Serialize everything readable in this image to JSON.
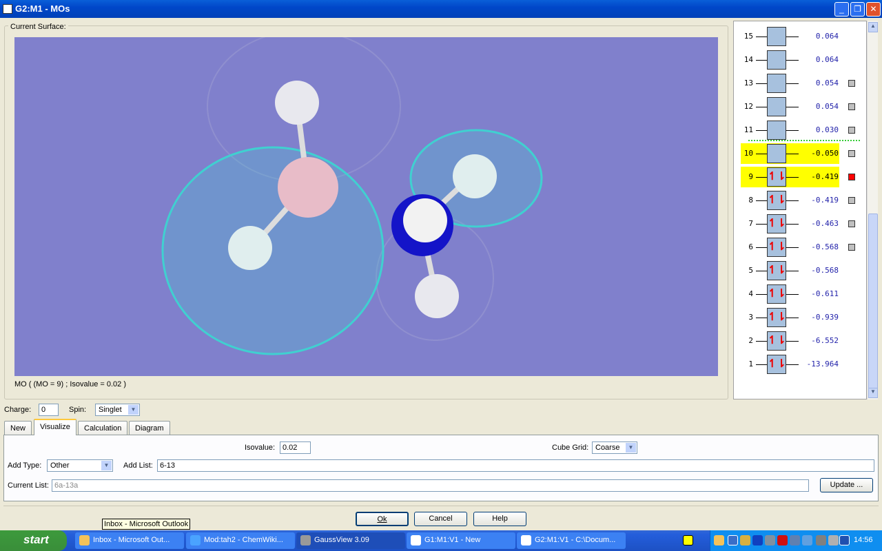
{
  "window": {
    "title": "G2:M1 - MOs"
  },
  "surface": {
    "group_label": "Current Surface:",
    "caption": "MO ( (MO = 9) ; Isovalue = 0.02 )"
  },
  "mo_levels": [
    {
      "n": "15",
      "energy": "0.064",
      "occupied": false,
      "highlight": false,
      "check": "none"
    },
    {
      "n": "14",
      "energy": "0.064",
      "occupied": false,
      "highlight": false,
      "check": "none"
    },
    {
      "n": "13",
      "energy": "0.054",
      "occupied": false,
      "highlight": false,
      "check": "gray"
    },
    {
      "n": "12",
      "energy": "0.054",
      "occupied": false,
      "highlight": false,
      "check": "gray"
    },
    {
      "n": "11",
      "energy": "0.030",
      "occupied": false,
      "highlight": false,
      "check": "gray"
    },
    {
      "n": "10",
      "energy": "-0.050",
      "occupied": false,
      "highlight": true,
      "check": "gray"
    },
    {
      "n": "9",
      "energy": "-0.419",
      "occupied": true,
      "highlight": true,
      "check": "red"
    },
    {
      "n": "8",
      "energy": "-0.419",
      "occupied": true,
      "highlight": false,
      "check": "gray"
    },
    {
      "n": "7",
      "energy": "-0.463",
      "occupied": true,
      "highlight": false,
      "check": "gray"
    },
    {
      "n": "6",
      "energy": "-0.568",
      "occupied": true,
      "highlight": false,
      "check": "gray"
    },
    {
      "n": "5",
      "energy": "-0.568",
      "occupied": true,
      "highlight": false,
      "check": "none"
    },
    {
      "n": "4",
      "energy": "-0.611",
      "occupied": true,
      "highlight": false,
      "check": "none"
    },
    {
      "n": "3",
      "energy": "-0.939",
      "occupied": true,
      "highlight": false,
      "check": "none"
    },
    {
      "n": "2",
      "energy": "-6.552",
      "occupied": true,
      "highlight": false,
      "check": "none"
    },
    {
      "n": "1",
      "energy": "-13.964",
      "occupied": true,
      "highlight": false,
      "check": "none"
    }
  ],
  "charge": {
    "label": "Charge:",
    "value": "0"
  },
  "spin": {
    "label": "Spin:",
    "value": "Singlet"
  },
  "tabs": [
    "New",
    "Visualize",
    "Calculation",
    "Diagram"
  ],
  "visualize": {
    "isovalue_label": "Isovalue:",
    "isovalue": "0.02",
    "cube_grid_label": "Cube Grid:",
    "cube_grid": "Coarse",
    "add_type_label": "Add Type:",
    "add_type": "Other",
    "add_list_label": "Add List:",
    "add_list": "6-13",
    "current_list_label": "Current List:",
    "current_list": "6a-13a",
    "update_label": "Update ..."
  },
  "buttons": {
    "ok": "Ok",
    "cancel": "Cancel",
    "help": "Help"
  },
  "tooltip": "Inbox - Microsoft Outlook",
  "taskbar": {
    "start": "start",
    "tasks": [
      "Inbox - Microsoft Out...",
      "Mod:tah2 - ChemWiki...",
      "GaussView 3.09",
      "G1:M1:V1 - New",
      "G2:M1:V1 - C:\\Docum..."
    ],
    "clock": "14:56"
  }
}
